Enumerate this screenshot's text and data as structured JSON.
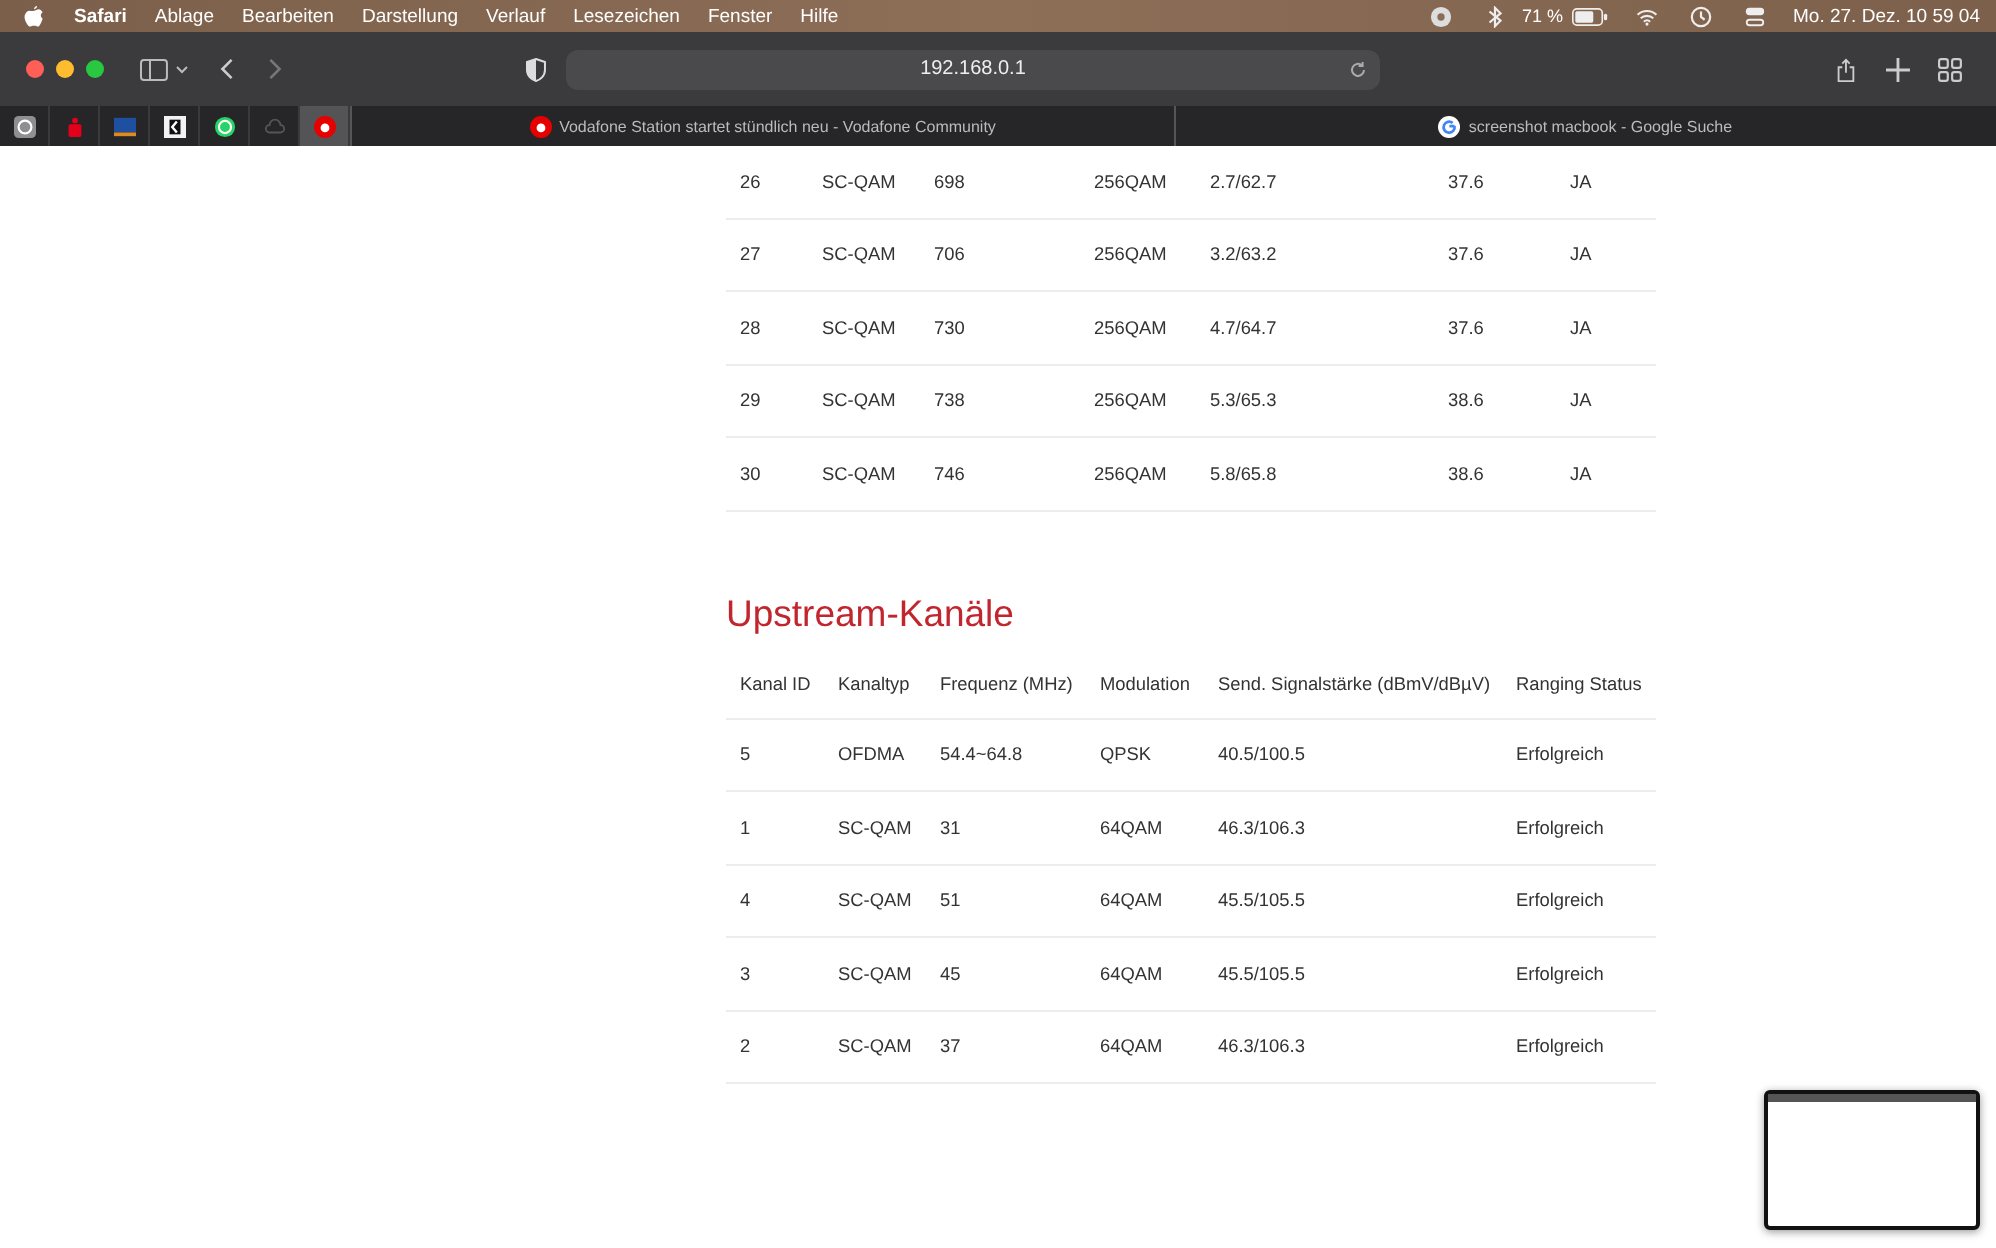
{
  "menu_bar": {
    "items": [
      {
        "label": "Safari",
        "kind": "app"
      },
      {
        "label": "Ablage",
        "kind": "menu"
      },
      {
        "label": "Bearbeiten",
        "kind": "menu"
      },
      {
        "label": "Darstellung",
        "kind": "menu"
      },
      {
        "label": "Verlauf",
        "kind": "menu"
      },
      {
        "label": "Lesezeichen",
        "kind": "menu"
      },
      {
        "label": "Fenster",
        "kind": "menu"
      },
      {
        "label": "Hilfe",
        "kind": "menu"
      }
    ],
    "battery": "71 %",
    "clock": "Mo. 27. Dez.  10 59 04"
  },
  "toolbar": {
    "url": "192.168.0.1"
  },
  "pinned_tabs": [
    {
      "kind": "letter",
      "selected": false
    },
    {
      "kind": "bank",
      "selected": false
    },
    {
      "kind": "flag",
      "selected": false
    },
    {
      "kind": "mark",
      "selected": false
    },
    {
      "kind": "chat",
      "selected": false
    },
    {
      "kind": "cloud",
      "selected": false
    },
    {
      "kind": "drop",
      "selected": true
    }
  ],
  "tabs": [
    {
      "label": "Vodafone Station startet stündlich neu - Vodafone Community",
      "kind": "drop",
      "selected": false
    },
    {
      "label": "screenshot macbook - Google Suche",
      "kind": "google",
      "selected": false
    }
  ],
  "downstream_table": {
    "rows": [
      [
        "26",
        "SC-QAM",
        "698",
        "256QAM",
        "2.7/62.7",
        "37.6",
        "JA"
      ],
      [
        "27",
        "SC-QAM",
        "706",
        "256QAM",
        "3.2/63.2",
        "37.6",
        "JA"
      ],
      [
        "28",
        "SC-QAM",
        "730",
        "256QAM",
        "4.7/64.7",
        "37.6",
        "JA"
      ],
      [
        "29",
        "SC-QAM",
        "738",
        "256QAM",
        "5.3/65.3",
        "38.6",
        "JA"
      ],
      [
        "30",
        "SC-QAM",
        "746",
        "256QAM",
        "5.8/65.8",
        "38.6",
        "JA"
      ]
    ]
  },
  "upstream": {
    "title": "Upstream-Kanäle",
    "columns": [
      "Kanal ID",
      "Kanaltyp",
      "Frequenz (MHz)",
      "Modulation",
      "Send. Signalstärke (dBmV/dBµV)",
      "Ranging Status"
    ],
    "rows": [
      [
        "5",
        "OFDMA",
        "54.4~64.8",
        "QPSK",
        "40.5/100.5",
        "Erfolgreich"
      ],
      [
        "1",
        "SC-QAM",
        "31",
        "64QAM",
        "46.3/106.3",
        "Erfolgreich"
      ],
      [
        "4",
        "SC-QAM",
        "51",
        "64QAM",
        "45.5/105.5",
        "Erfolgreich"
      ],
      [
        "3",
        "SC-QAM",
        "45",
        "64QAM",
        "45.5/105.5",
        "Erfolgreich"
      ],
      [
        "2",
        "SC-QAM",
        "37",
        "64QAM",
        "46.3/106.3",
        "Erfolgreich"
      ]
    ]
  }
}
